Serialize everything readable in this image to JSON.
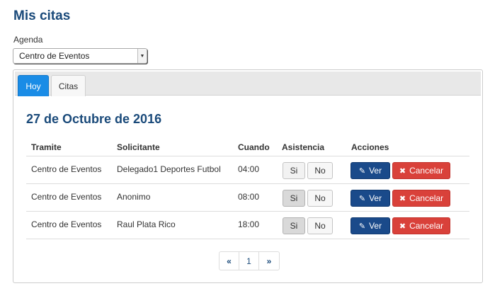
{
  "page": {
    "title": "Mis citas"
  },
  "agenda": {
    "label": "Agenda",
    "selected": "Centro de Eventos"
  },
  "tabs": [
    {
      "label": "Hoy",
      "active": true
    },
    {
      "label": "Citas",
      "active": false
    }
  ],
  "date_heading": "27 de Octubre de 2016",
  "table": {
    "headers": {
      "tramite": "Tramite",
      "solicitante": "Solicitante",
      "cuando": "Cuando",
      "asistencia": "Asistencia",
      "acciones": "Acciones"
    },
    "rows": [
      {
        "tramite": "Centro de Eventos",
        "solicitante": "Delegado1 Deportes Futbol",
        "cuando": "04:00",
        "si_pressed": false
      },
      {
        "tramite": "Centro de Eventos",
        "solicitante": "Anonimo",
        "cuando": "08:00",
        "si_pressed": true
      },
      {
        "tramite": "Centro de Eventos",
        "solicitante": "Raul Plata Rico",
        "cuando": "18:00",
        "si_pressed": true
      }
    ]
  },
  "buttons": {
    "si": "Si",
    "no": "No",
    "ver": "Ver",
    "cancelar": "Cancelar"
  },
  "pagination": {
    "prev": "«",
    "current": "1",
    "next": "»"
  },
  "colors": {
    "primary_dark": "#1a4a8a",
    "tab_active": "#1a8ce6",
    "danger": "#d9413a"
  }
}
